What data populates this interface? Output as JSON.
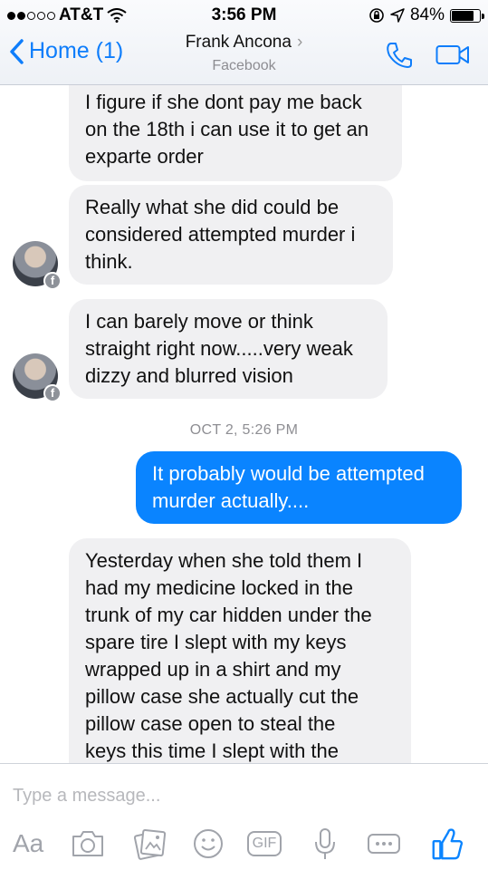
{
  "status": {
    "carrier": "AT&T",
    "time": "3:56 PM",
    "battery": "84%",
    "battery_level": 0.84
  },
  "header": {
    "back_label": "Home (1)",
    "contact_name": "Frank Ancona",
    "contact_source": "Facebook",
    "icons": [
      "chevron-left-icon",
      "phone-icon",
      "video-camera-icon"
    ]
  },
  "messages": [
    {
      "direction": "in",
      "lines": [
        "I figure if she dont pay me back",
        "on the 18th i can use it to get an",
        "exparte order"
      ]
    },
    {
      "direction": "in",
      "lines": [
        "Really what she did could be",
        "considered attempted murder i",
        "think."
      ]
    },
    {
      "direction": "in",
      "lines": [
        "I can barely move or think",
        "straight right now.....very weak",
        "dizzy and blurred vision"
      ]
    },
    {
      "direction": "out",
      "lines": [
        "It probably would be attempted",
        "murder actually...."
      ]
    },
    {
      "direction": "in",
      "lines": [
        "Yesterday when she told them I",
        "had my medicine locked in the",
        "trunk of my car hidden under the",
        "spare tire I slept with my keys",
        "wrapped up in a shirt and my",
        "pillow case she actually cut the",
        "pillow case open to steal the",
        "keys this time I slept with the"
      ]
    }
  ],
  "timestamp": "OCT 2, 5:26 PM",
  "composer": {
    "placeholder": "Type a message...",
    "aa_label": "Aa",
    "gif_label": "GIF",
    "tools": [
      "camera-icon",
      "photo-icon",
      "emoji-icon",
      "gif-icon",
      "microphone-icon",
      "more-icon",
      "thumbs-up-icon"
    ]
  },
  "colors": {
    "accent": "#0a84ff",
    "incoming_bubble": "#f0f0f2",
    "link": "#0e7dfb"
  }
}
